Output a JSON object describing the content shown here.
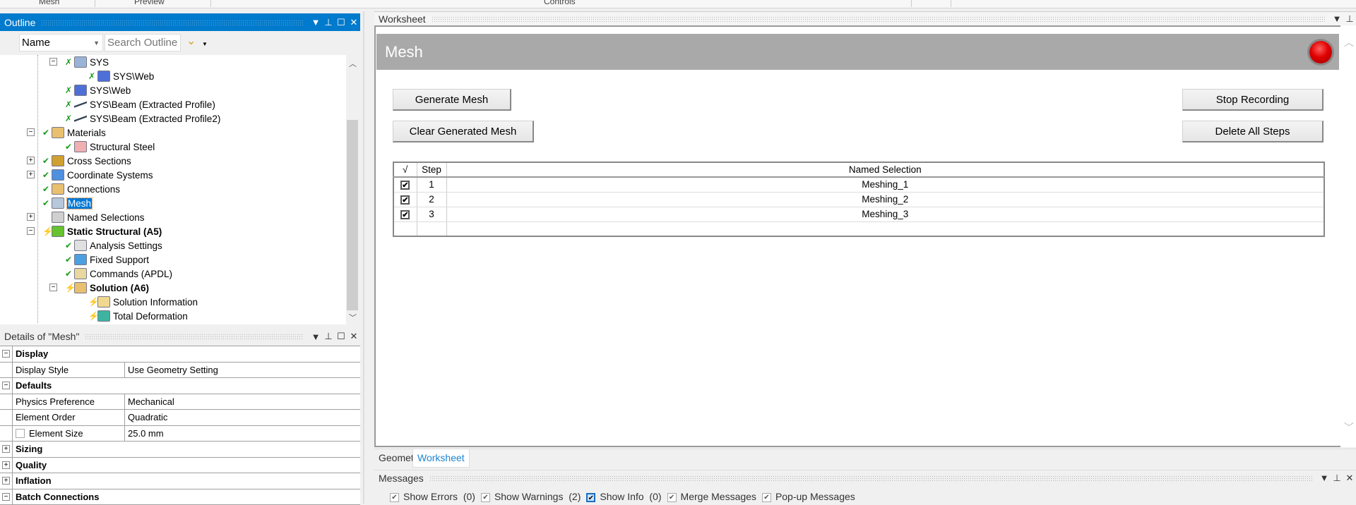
{
  "ribbon": {
    "groups": [
      "Mesh",
      "Preview",
      "Controls"
    ]
  },
  "outline": {
    "title": "Outline",
    "filter_value": "Name",
    "search_placeholder": "Search Outline",
    "items": [
      {
        "label": "SYS",
        "level": 3,
        "exp": "-",
        "status": "x",
        "icon": "#9ab4d8"
      },
      {
        "label": "SYS\\Web",
        "level": 4,
        "exp": "",
        "status": "x",
        "icon": "#4d6fd8"
      },
      {
        "label": "SYS\\Web",
        "level": 3,
        "exp": "",
        "status": "x",
        "icon": "#4d6fd8"
      },
      {
        "label": "SYS\\Beam (Extracted Profile)",
        "level": 3,
        "exp": "",
        "status": "x",
        "icon": "line"
      },
      {
        "label": "SYS\\Beam (Extracted Profile2)",
        "level": 3,
        "exp": "",
        "status": "x",
        "icon": "line"
      },
      {
        "label": "Materials",
        "level": 2,
        "exp": "-",
        "status": "check",
        "icon": "#e8c070"
      },
      {
        "label": "Structural Steel",
        "level": 3,
        "exp": "",
        "status": "check",
        "icon": "#f0b0b0"
      },
      {
        "label": "Cross Sections",
        "level": 2,
        "exp": "+",
        "status": "check",
        "icon": "#d0a030"
      },
      {
        "label": "Coordinate Systems",
        "level": 2,
        "exp": "+",
        "status": "check",
        "icon": "#5090e0"
      },
      {
        "label": "Connections",
        "level": 2,
        "exp": "",
        "status": "check",
        "icon": "#e8c070"
      },
      {
        "label": "Mesh",
        "level": 2,
        "exp": "",
        "status": "check",
        "icon": "#b8c8dc",
        "selected": true
      },
      {
        "label": "Named Selections",
        "level": 2,
        "exp": "+",
        "status": "",
        "icon": "#d0d0d0"
      },
      {
        "label": "Static Structural (A5)",
        "level": 2,
        "exp": "-",
        "status": "bolt",
        "icon": "#66c22e",
        "bold": true
      },
      {
        "label": "Analysis Settings",
        "level": 3,
        "exp": "",
        "status": "check",
        "icon": "#e0e0e0"
      },
      {
        "label": "Fixed Support",
        "level": 3,
        "exp": "",
        "status": "check",
        "icon": "#4aa0e0"
      },
      {
        "label": "Commands (APDL)",
        "level": 3,
        "exp": "",
        "status": "check",
        "icon": "#e8d8a0"
      },
      {
        "label": "Solution (A6)",
        "level": 3,
        "exp": "-",
        "status": "bolt",
        "icon": "#e8c070",
        "bold": true
      },
      {
        "label": "Solution Information",
        "level": 4,
        "exp": "",
        "status": "bolt",
        "icon": "#f0d890"
      },
      {
        "label": "Total Deformation",
        "level": 4,
        "exp": "",
        "status": "bolt",
        "icon": "#3cb4a0"
      }
    ]
  },
  "details": {
    "title": "Details of \"Mesh\"",
    "rows": [
      {
        "type": "cat",
        "exp": "-",
        "label": "Display"
      },
      {
        "type": "prop",
        "label": "Display Style",
        "value": "Use Geometry Setting"
      },
      {
        "type": "cat",
        "exp": "-",
        "label": "Defaults"
      },
      {
        "type": "prop",
        "label": "Physics Preference",
        "value": "Mechanical"
      },
      {
        "type": "prop",
        "label": "Element Order",
        "value": "Quadratic"
      },
      {
        "type": "prop",
        "label": "Element Size",
        "value": "25.0 mm",
        "checkbox": true
      },
      {
        "type": "cat",
        "exp": "+",
        "label": "Sizing"
      },
      {
        "type": "cat",
        "exp": "+",
        "label": "Quality"
      },
      {
        "type": "cat",
        "exp": "+",
        "label": "Inflation"
      },
      {
        "type": "cat",
        "exp": "-",
        "label": "Batch Connections"
      }
    ]
  },
  "worksheet": {
    "title": "Worksheet",
    "heading": "Mesh",
    "buttons": {
      "generate": "Generate Mesh",
      "clear": "Clear Generated Mesh",
      "stop": "Stop Recording",
      "delete": "Delete All Steps"
    },
    "table": {
      "headers": [
        "√",
        "Step",
        "Named Selection"
      ],
      "rows": [
        {
          "checked": true,
          "step": "1",
          "name": "Meshing_1"
        },
        {
          "checked": true,
          "step": "2",
          "name": "Meshing_2"
        },
        {
          "checked": true,
          "step": "3",
          "name": "Meshing_3"
        }
      ]
    },
    "tabs": [
      "Geometry",
      "Worksheet"
    ],
    "active_tab": "Worksheet"
  },
  "messages": {
    "title": "Messages",
    "filters": [
      {
        "label": "Show Errors",
        "count": "(0)",
        "checked": true
      },
      {
        "label": "Show Warnings",
        "count": "(2)",
        "checked": true
      },
      {
        "label": "Show Info",
        "count": "(0)",
        "checked": true,
        "active": true
      },
      {
        "label": "Merge Messages",
        "count": "",
        "checked": true
      },
      {
        "label": "Pop-up Messages",
        "count": "",
        "checked": true
      }
    ]
  },
  "colors": {
    "accent": "#007acc",
    "record": "#e00000",
    "header_gray": "#a9a9a9"
  }
}
